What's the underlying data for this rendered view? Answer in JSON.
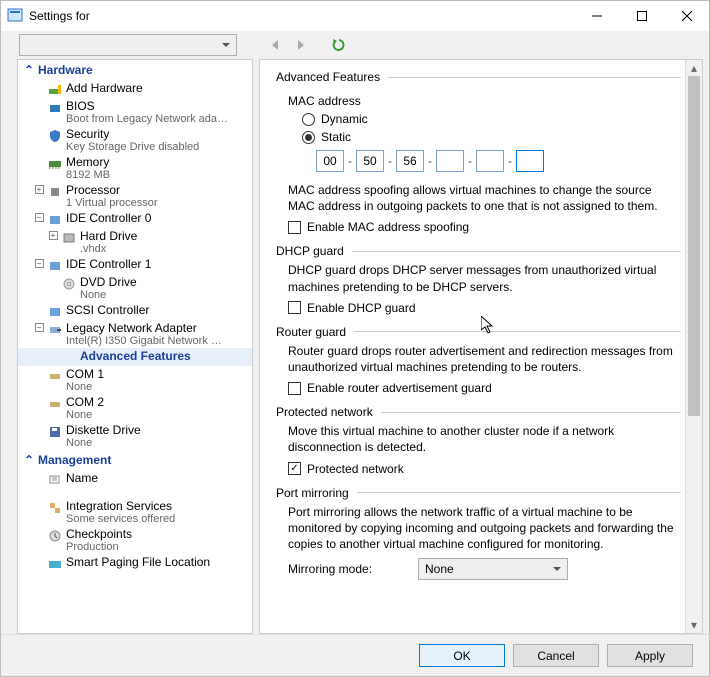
{
  "window": {
    "title": "Settings for"
  },
  "nav": {
    "hardware": {
      "header": "Hardware"
    },
    "management": {
      "header": "Management"
    },
    "items": {
      "add_hw": {
        "label": "Add Hardware"
      },
      "bios": {
        "label": "BIOS",
        "sub": "Boot from Legacy Network ada…"
      },
      "security": {
        "label": "Security",
        "sub": "Key Storage Drive disabled"
      },
      "memory": {
        "label": "Memory",
        "sub": "8192 MB"
      },
      "processor": {
        "label": "Processor",
        "sub": "1 Virtual processor"
      },
      "ide0": {
        "label": "IDE Controller 0"
      },
      "hdd": {
        "label": "Hard Drive",
        "sub": ".vhdx"
      },
      "ide1": {
        "label": "IDE Controller 1"
      },
      "dvd": {
        "label": "DVD Drive",
        "sub": "None"
      },
      "scsi": {
        "label": "SCSI Controller"
      },
      "legacy_nic": {
        "label": "Legacy Network Adapter",
        "sub": "Intel(R) I350 Gigabit Network …"
      },
      "advanced": {
        "label": "Advanced Features"
      },
      "com1": {
        "label": "COM 1",
        "sub": "None"
      },
      "com2": {
        "label": "COM 2",
        "sub": "None"
      },
      "diskette": {
        "label": "Diskette Drive",
        "sub": "None"
      },
      "name": {
        "label": "Name"
      },
      "integ": {
        "label": "Integration Services",
        "sub": "Some services offered"
      },
      "chkpt": {
        "label": "Checkpoints",
        "sub": "Production"
      },
      "paging": {
        "label": "Smart Paging File Location"
      }
    }
  },
  "panel": {
    "title": "Advanced Features",
    "mac": {
      "header": "MAC address",
      "dynamic": "Dynamic",
      "static": "Static",
      "octets": [
        "00",
        "50",
        "56",
        "",
        "",
        ""
      ],
      "spoof_desc": "MAC address spoofing allows virtual machines to change the source MAC address in outgoing packets to one that is not assigned to them.",
      "spoof_chk": "Enable MAC address spoofing"
    },
    "dhcp": {
      "header": "DHCP guard",
      "desc": "DHCP guard drops DHCP server messages from unauthorized virtual machines pretending to be DHCP servers.",
      "chk": "Enable DHCP guard"
    },
    "router": {
      "header": "Router guard",
      "desc": "Router guard drops router advertisement and redirection messages from unauthorized virtual machines pretending to be routers.",
      "chk": "Enable router advertisement guard"
    },
    "protected": {
      "header": "Protected network",
      "desc": "Move this virtual machine to another cluster node if a network disconnection is detected.",
      "chk": "Protected network"
    },
    "mirror": {
      "header": "Port mirroring",
      "desc": "Port mirroring allows the network traffic of a virtual machine to be monitored by copying incoming and outgoing packets and forwarding the copies to another virtual machine configured for monitoring.",
      "mode_lbl": "Mirroring mode:",
      "mode_val": "None"
    }
  },
  "footer": {
    "ok": "OK",
    "cancel": "Cancel",
    "apply": "Apply"
  }
}
